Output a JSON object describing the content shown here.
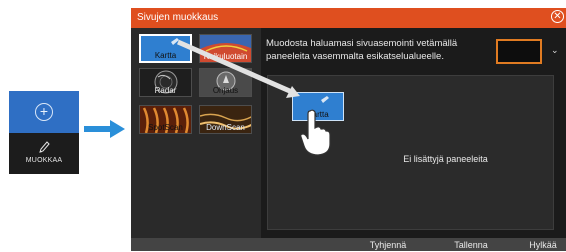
{
  "mini_panel": {
    "add_icon": "plus-circle-icon",
    "edit_icon": "pencil-icon",
    "edit_label": "MUOKKAA"
  },
  "dialog": {
    "title": "Sivujen muokkaus",
    "close_icon": "close-circle-icon",
    "instructions": "Muodosta haluamasi sivuasemointi vetämällä paneeleita vasemmalta esikatselualueelle.",
    "empty_text": "Ei lisättyjä paneeleita",
    "tiles": [
      {
        "label": "Kartta",
        "selected": true
      },
      {
        "label": "Kaikuluotain",
        "selected": false
      },
      {
        "label": "Radar",
        "selected": false
      },
      {
        "label": "Ohjaus",
        "selected": false
      },
      {
        "label": "SpotScan",
        "selected": false
      },
      {
        "label": "DownScan",
        "selected": false
      }
    ],
    "dragged_tile_label": "Kartta",
    "buttons": {
      "clear": "Tyhjennä",
      "save": "Tallenna",
      "cancel": "Hylkää"
    }
  },
  "colors": {
    "titlebar": "#df4f1f",
    "accent_blue": "#2f6fc4",
    "swatch_border": "#e07b22"
  }
}
